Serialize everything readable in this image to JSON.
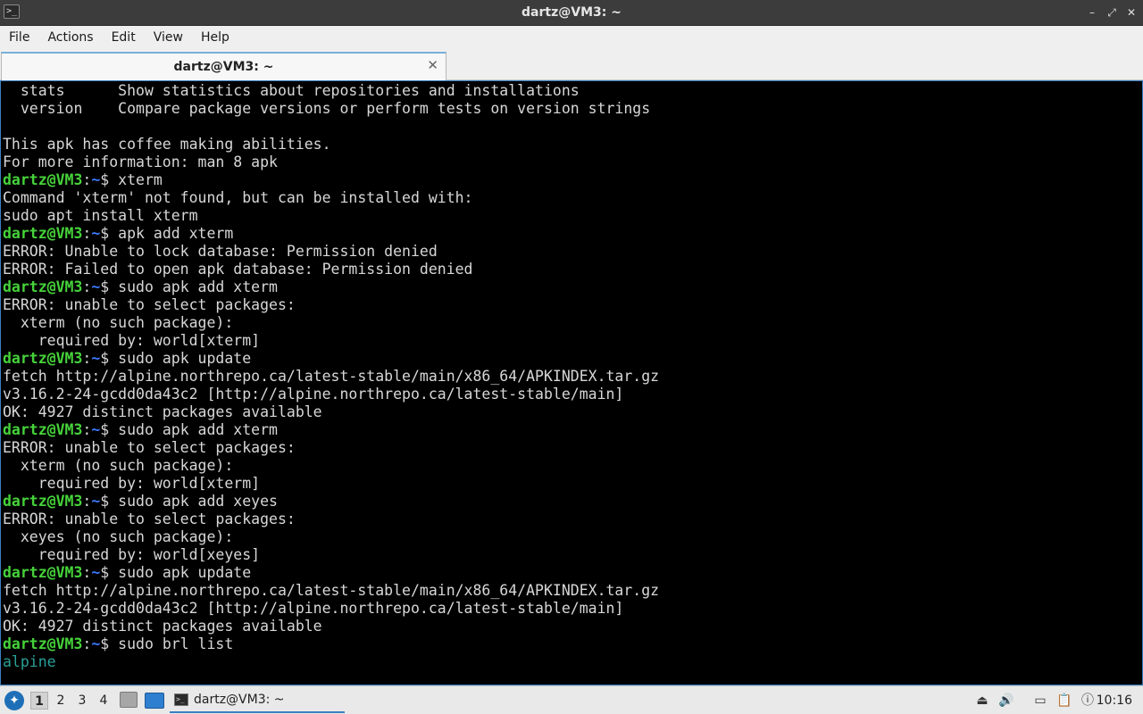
{
  "window": {
    "title": "dartz@VM3: ~",
    "buttons": {
      "minimize": "–",
      "maximize": "⤢",
      "close": "✕"
    }
  },
  "menu": [
    "File",
    "Actions",
    "Edit",
    "View",
    "Help"
  ],
  "tab": {
    "label": "dartz@VM3: ~",
    "close": "✕"
  },
  "terminal": {
    "user": "dartz@VM3",
    "path": "~",
    "lines": [
      {
        "type": "out",
        "text": "  stats      Show statistics about repositories and installations"
      },
      {
        "type": "out",
        "text": "  version    Compare package versions or perform tests on version strings"
      },
      {
        "type": "out",
        "text": ""
      },
      {
        "type": "out",
        "text": "This apk has coffee making abilities."
      },
      {
        "type": "out",
        "text": "For more information: man 8 apk"
      },
      {
        "type": "cmd",
        "text": " xterm"
      },
      {
        "type": "out",
        "text": "Command 'xterm' not found, but can be installed with:"
      },
      {
        "type": "out",
        "text": "sudo apt install xterm"
      },
      {
        "type": "cmd",
        "text": " apk add xterm"
      },
      {
        "type": "out",
        "text": "ERROR: Unable to lock database: Permission denied"
      },
      {
        "type": "out",
        "text": "ERROR: Failed to open apk database: Permission denied"
      },
      {
        "type": "cmd",
        "text": " sudo apk add xterm"
      },
      {
        "type": "out",
        "text": "ERROR: unable to select packages:"
      },
      {
        "type": "out",
        "text": "  xterm (no such package):"
      },
      {
        "type": "out",
        "text": "    required by: world[xterm]"
      },
      {
        "type": "cmd",
        "text": " sudo apk update"
      },
      {
        "type": "out",
        "text": "fetch http://alpine.northrepo.ca/latest-stable/main/x86_64/APKINDEX.tar.gz"
      },
      {
        "type": "out",
        "text": "v3.16.2-24-gcdd0da43c2 [http://alpine.northrepo.ca/latest-stable/main]"
      },
      {
        "type": "out",
        "text": "OK: 4927 distinct packages available"
      },
      {
        "type": "cmd",
        "text": " sudo apk add xterm"
      },
      {
        "type": "out",
        "text": "ERROR: unable to select packages:"
      },
      {
        "type": "out",
        "text": "  xterm (no such package):"
      },
      {
        "type": "out",
        "text": "    required by: world[xterm]"
      },
      {
        "type": "cmd",
        "text": " sudo apk add xeyes"
      },
      {
        "type": "out",
        "text": "ERROR: unable to select packages:"
      },
      {
        "type": "out",
        "text": "  xeyes (no such package):"
      },
      {
        "type": "out",
        "text": "    required by: world[xeyes]"
      },
      {
        "type": "cmd",
        "text": " sudo apk update"
      },
      {
        "type": "out",
        "text": "fetch http://alpine.northrepo.ca/latest-stable/main/x86_64/APKINDEX.tar.gz"
      },
      {
        "type": "out",
        "text": "v3.16.2-24-gcdd0da43c2 [http://alpine.northrepo.ca/latest-stable/main]"
      },
      {
        "type": "out",
        "text": "OK: 4927 distinct packages available"
      },
      {
        "type": "cmd",
        "text": " sudo brl list"
      },
      {
        "type": "cyan",
        "text": "alpine"
      }
    ]
  },
  "taskbar": {
    "workspaces": [
      "1",
      "2",
      "3",
      "4"
    ],
    "active_workspace": "1",
    "task_label": "dartz@VM3: ~",
    "tray_icons": [
      "eject-icon",
      "volume-icon",
      "network-icon",
      "clipboard-icon",
      "updates-icon"
    ],
    "clock": "10:16"
  },
  "colors": {
    "prompt_user": "#46d23a",
    "prompt_path": "#3b78ff",
    "terminal_bg": "#000000",
    "terminal_fg": "#d7d7d7",
    "accent": "#3d7fc0"
  }
}
